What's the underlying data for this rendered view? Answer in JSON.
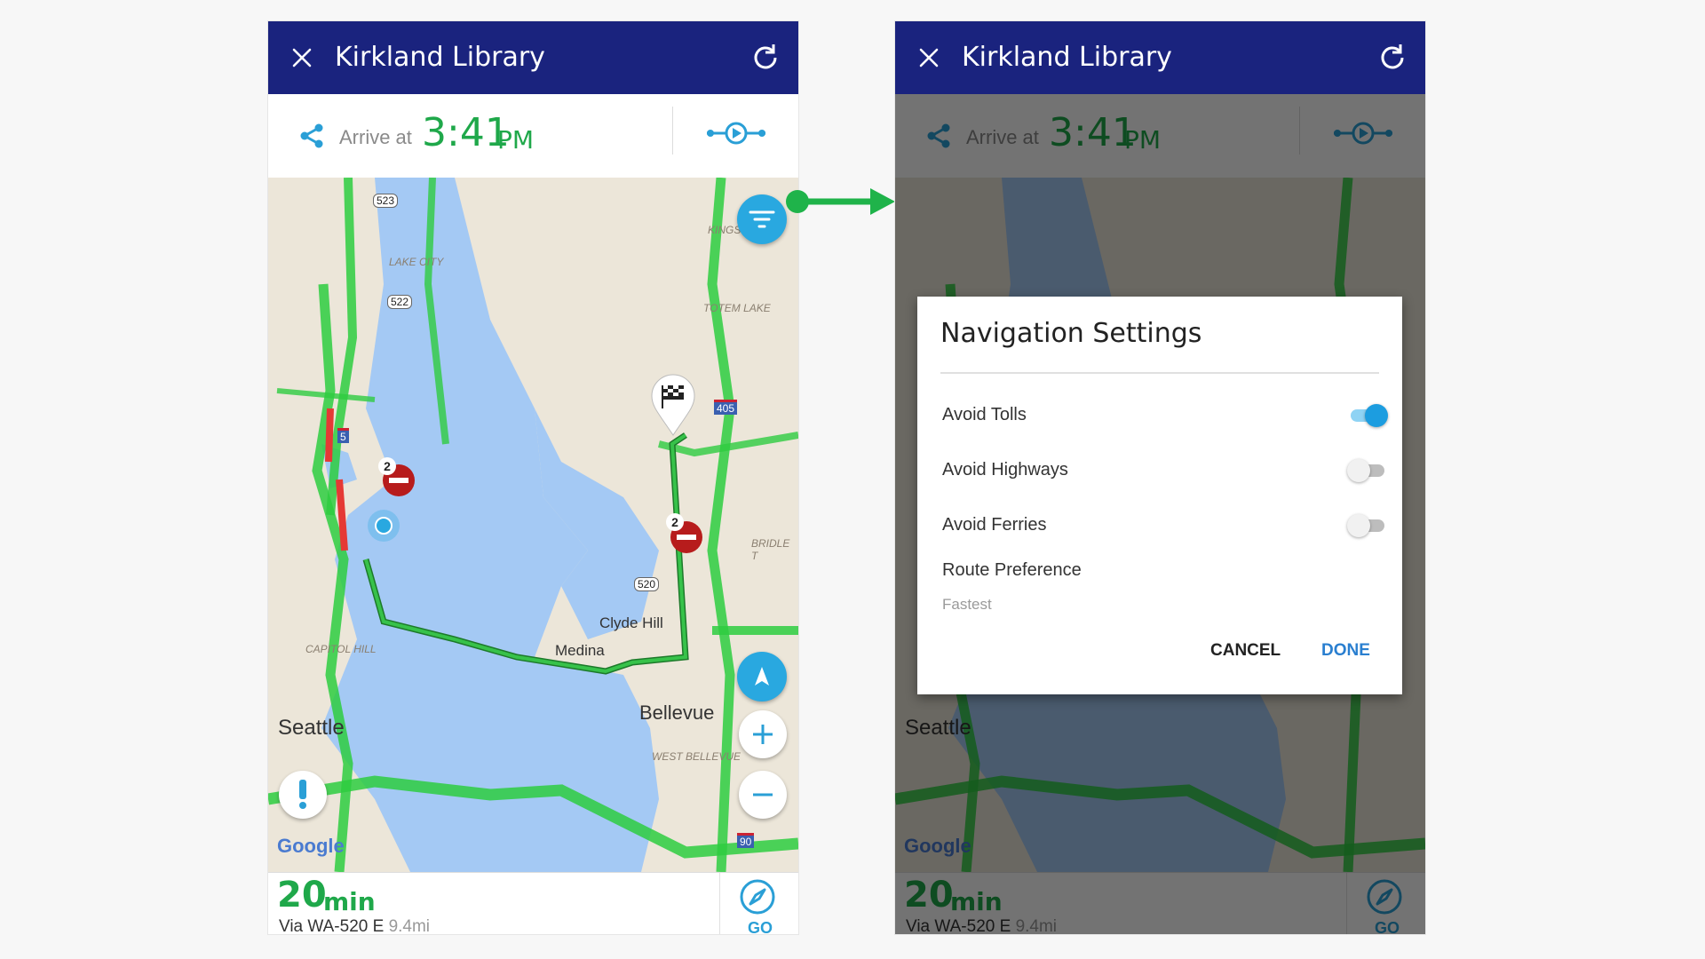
{
  "header": {
    "title": "Kirkland Library"
  },
  "arrival": {
    "label": "Arrive at",
    "time": "3:41",
    "ampm": "PM"
  },
  "map": {
    "labels": {
      "lake_city": "LAKE CITY",
      "totem_lake": "TOTEM LAKE",
      "kings": "KINGS",
      "capitol_hill": "CAPITOL HILL",
      "seattle": "Seattle",
      "medina": "Medina",
      "clyde_hill": "Clyde Hill",
      "bellevue": "Bellevue",
      "west_bellevue": "WEST BELLEVUE",
      "bridle": "BRIDLE T",
      "google": "Google"
    },
    "shields": {
      "r523": "523",
      "r522": "522",
      "i405": "405",
      "i5": "5",
      "r520": "520",
      "i90": "90"
    },
    "incidents": {
      "count_a": "2",
      "count_b": "2"
    }
  },
  "trip": {
    "eta_value": "20",
    "eta_unit": "min",
    "via": "Via WA-520 E",
    "distance": "9.4mi",
    "go_label": "GO"
  },
  "dialog": {
    "title": "Navigation Settings",
    "options": [
      {
        "label": "Avoid Tolls",
        "enabled": true
      },
      {
        "label": "Avoid Highways",
        "enabled": false
      },
      {
        "label": "Avoid Ferries",
        "enabled": false
      }
    ],
    "route_preference_label": "Route Preference",
    "route_preference_value": "Fastest",
    "cancel_label": "CANCEL",
    "done_label": "DONE"
  },
  "colors": {
    "header": "#1a237e",
    "accent": "#29a8e0",
    "route": "#1fa84a",
    "connector_arrow": "#1fb34a"
  },
  "icons": [
    "close-icon",
    "refresh-icon",
    "share-icon",
    "route-options-icon",
    "filter-icon",
    "compass-icon",
    "plus-icon",
    "minus-icon",
    "alert-icon",
    "finish-flag-icon",
    "location-dot-icon",
    "incident-icon",
    "navigate-icon"
  ]
}
